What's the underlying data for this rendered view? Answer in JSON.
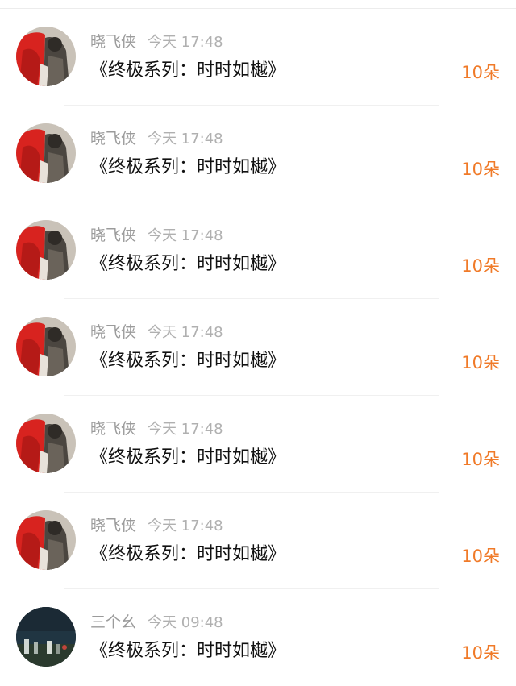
{
  "comments": [
    {
      "author": "晓飞侠",
      "time": "今天 17:48",
      "text": "《终极系列：时时如樾》",
      "gift": "10朵",
      "avatar_icon": "red-figure-avatar"
    },
    {
      "author": "晓飞侠",
      "time": "今天 17:48",
      "text": "《终极系列：时时如樾》",
      "gift": "10朵",
      "avatar_icon": "red-figure-avatar"
    },
    {
      "author": "晓飞侠",
      "time": "今天 17:48",
      "text": "《终极系列：时时如樾》",
      "gift": "10朵",
      "avatar_icon": "red-figure-avatar"
    },
    {
      "author": "晓飞侠",
      "time": "今天 17:48",
      "text": "《终极系列：时时如樾》",
      "gift": "10朵",
      "avatar_icon": "red-figure-avatar"
    },
    {
      "author": "晓飞侠",
      "time": "今天 17:48",
      "text": "《终极系列：时时如樾》",
      "gift": "10朵",
      "avatar_icon": "red-figure-avatar"
    },
    {
      "author": "晓飞侠",
      "time": "今天 17:48",
      "text": "《终极系列：时时如樾》",
      "gift": "10朵",
      "avatar_icon": "red-figure-avatar"
    },
    {
      "author": "三个幺",
      "time": "今天 09:48",
      "text": "《终极系列：时时如樾》",
      "gift": "10朵",
      "avatar_icon": "night-street-avatar"
    }
  ],
  "colors": {
    "name": "#9b9b9b",
    "time": "#b0b0b0",
    "text": "#111111",
    "gift": "#f07a28",
    "divider": "#f0f0f0"
  }
}
